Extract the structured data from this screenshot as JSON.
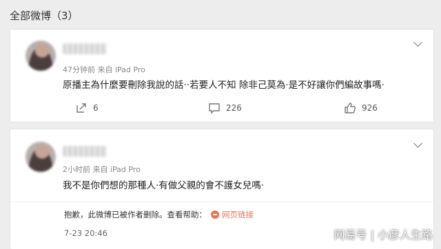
{
  "header": {
    "title": "全部微博（3）"
  },
  "posts": [
    {
      "meta": "47分钟前 来自 iPad Pro",
      "content": "原播主為什麼要刪除我說的話··若要人不知 除非己莫為·是不好讓你們編故事嗎·",
      "actions": {
        "repost": "6",
        "comment": "226",
        "like": "926"
      }
    },
    {
      "meta": "2小时前 来自 iPad Pro",
      "content": "我不是你們想的那種人·有做父親的會不護女兒嗎·",
      "notice": "抱歉，此微博已被作者删除。查看帮助：",
      "notice_link": "网页链接",
      "time": "7-23 20:46"
    }
  ],
  "watermark": "网易号 | 小彦人生路",
  "icons": [
    "chevron-down-icon",
    "repost-icon",
    "comment-icon",
    "like-icon",
    "link-icon"
  ],
  "colors": {
    "link": "#eb7350",
    "background": "#ededed"
  }
}
